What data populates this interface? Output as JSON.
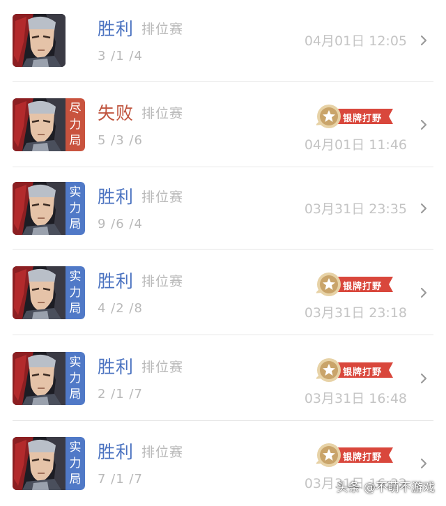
{
  "colors": {
    "win": "#4a72c0",
    "loss": "#c0553f",
    "tag_strength": "#5079c7",
    "tag_best_effort": "#c9533e",
    "badge_ribbon": "#d9473c",
    "badge_medal": "#c9a46a"
  },
  "matches": [
    {
      "result": "胜利",
      "outcome": "win",
      "mode": "排位赛",
      "kda": "3 /1 /4",
      "time": "04月01日 12:05",
      "tag": null,
      "badge": null
    },
    {
      "result": "失败",
      "outcome": "loss",
      "mode": "排位赛",
      "kda": "5 /3 /6",
      "time": "04月01日 11:46",
      "tag": {
        "chars": [
          "尽",
          "力",
          "局"
        ],
        "kind": "best_effort"
      },
      "badge": "银牌打野"
    },
    {
      "result": "胜利",
      "outcome": "win",
      "mode": "排位赛",
      "kda": "9 /6 /4",
      "time": "03月31日 23:35",
      "tag": {
        "chars": [
          "实",
          "力",
          "局"
        ],
        "kind": "strength"
      },
      "badge": null
    },
    {
      "result": "胜利",
      "outcome": "win",
      "mode": "排位赛",
      "kda": "4 /2 /8",
      "time": "03月31日 23:18",
      "tag": {
        "chars": [
          "实",
          "力",
          "局"
        ],
        "kind": "strength"
      },
      "badge": "银牌打野"
    },
    {
      "result": "胜利",
      "outcome": "win",
      "mode": "排位赛",
      "kda": "2 /1 /7",
      "time": "03月31日 16:48",
      "tag": {
        "chars": [
          "实",
          "力",
          "局"
        ],
        "kind": "strength"
      },
      "badge": "银牌打野"
    },
    {
      "result": "胜利",
      "outcome": "win",
      "mode": "排位赛",
      "kda": "7 /1 /7",
      "time": "03月31日 16:32",
      "tag": {
        "chars": [
          "实",
          "力",
          "局"
        ],
        "kind": "strength"
      },
      "badge": "银牌打野"
    }
  ],
  "watermark": "头条 @不萌不游戏"
}
